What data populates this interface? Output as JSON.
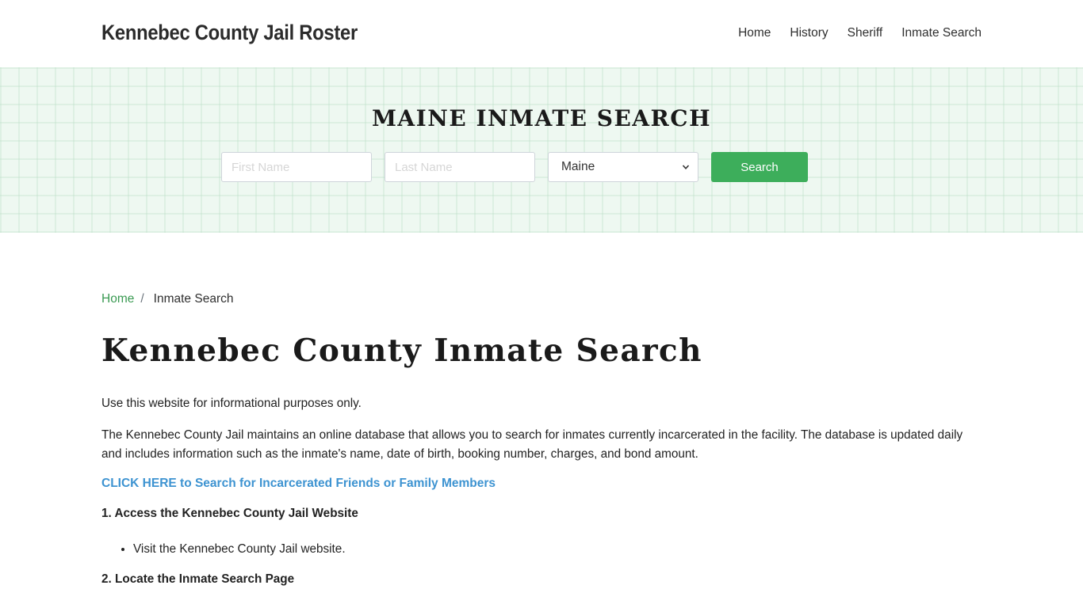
{
  "header": {
    "brand": "Kennebec County Jail Roster",
    "nav": [
      {
        "label": "Home"
      },
      {
        "label": "History"
      },
      {
        "label": "Sheriff"
      },
      {
        "label": "Inmate Search"
      }
    ]
  },
  "hero": {
    "title": "MAINE INMATE SEARCH",
    "first_name_placeholder": "First Name",
    "last_name_placeholder": "Last Name",
    "state_selected": "Maine",
    "search_label": "Search",
    "accent_color": "#3dae5b"
  },
  "breadcrumb": {
    "home": "Home",
    "separator": "/",
    "current": "Inmate Search"
  },
  "main": {
    "title": "Kennebec County Inmate Search",
    "intro": "Use this website for informational purposes only.",
    "description": "The Kennebec County Jail maintains an online database that allows you to search for inmates currently incarcerated in the facility. The database is updated daily and includes information such as the inmate's name, date of birth, booking number, charges, and bond amount.",
    "cta_link": "CLICK HERE to Search for Incarcerated Friends or Family Members",
    "steps": [
      {
        "heading": "1. Access the Kennebec County Jail Website",
        "bullets": [
          "Visit the Kennebec County Jail website."
        ]
      },
      {
        "heading": "2. Locate the Inmate Search Page"
      }
    ]
  }
}
